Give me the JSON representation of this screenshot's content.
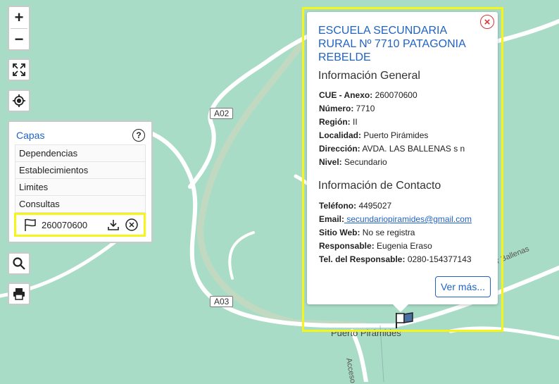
{
  "map": {
    "road_labels": {
      "a02": "A02",
      "a03": "A03"
    },
    "place_label": "Puerto Pirámides",
    "street_label": "Av. de las Ballenas",
    "street_label_partial": "r Ballenas",
    "access_label": "Acceso",
    "colors": {
      "land": "#a9dcc6",
      "road": "#ffffff",
      "highlight": "#f5f51a",
      "accent": "#1f63c4"
    }
  },
  "controls": {
    "zoom_in": "+",
    "zoom_out": "−",
    "icons": [
      "fullscreen-icon",
      "locate-icon",
      "search-icon",
      "print-icon"
    ]
  },
  "layers": {
    "title": "Capas",
    "help": "?",
    "items": [
      "Dependencias",
      "Establecimientos",
      "Limites",
      "Consultas"
    ],
    "result": {
      "code": "260070600"
    }
  },
  "popup": {
    "title": "ESCUELA SECUNDARIA RURAL Nº 7710 PATAGONIA REBELDE",
    "general_heading": "Información General",
    "general": [
      {
        "label": "CUE - Anexo:",
        "value": " 260070600"
      },
      {
        "label": "Número:",
        "value": " 7710"
      },
      {
        "label": "Región:",
        "value": " II"
      },
      {
        "label": "Localidad:",
        "value": " Puerto Pirámides"
      },
      {
        "label": "Dirección:",
        "value": " AVDA. LAS BALLENAS s n"
      },
      {
        "label": "Nivel:",
        "value": " Secundario"
      }
    ],
    "contact_heading": "Información de Contacto",
    "contact": {
      "phone_label": "Teléfono:",
      "phone": " 4495027",
      "email_label": "Email:",
      "email": " secundariopiramides@gmail.com",
      "web_label": "Sitio Web:",
      "web": " No se registra",
      "resp_label": "Responsable:",
      "resp": " Eugenia Eraso",
      "resp_tel_label": "Tel. del Responsable:",
      "resp_tel": " 0280-154377143"
    },
    "more_button": "Ver más..."
  }
}
